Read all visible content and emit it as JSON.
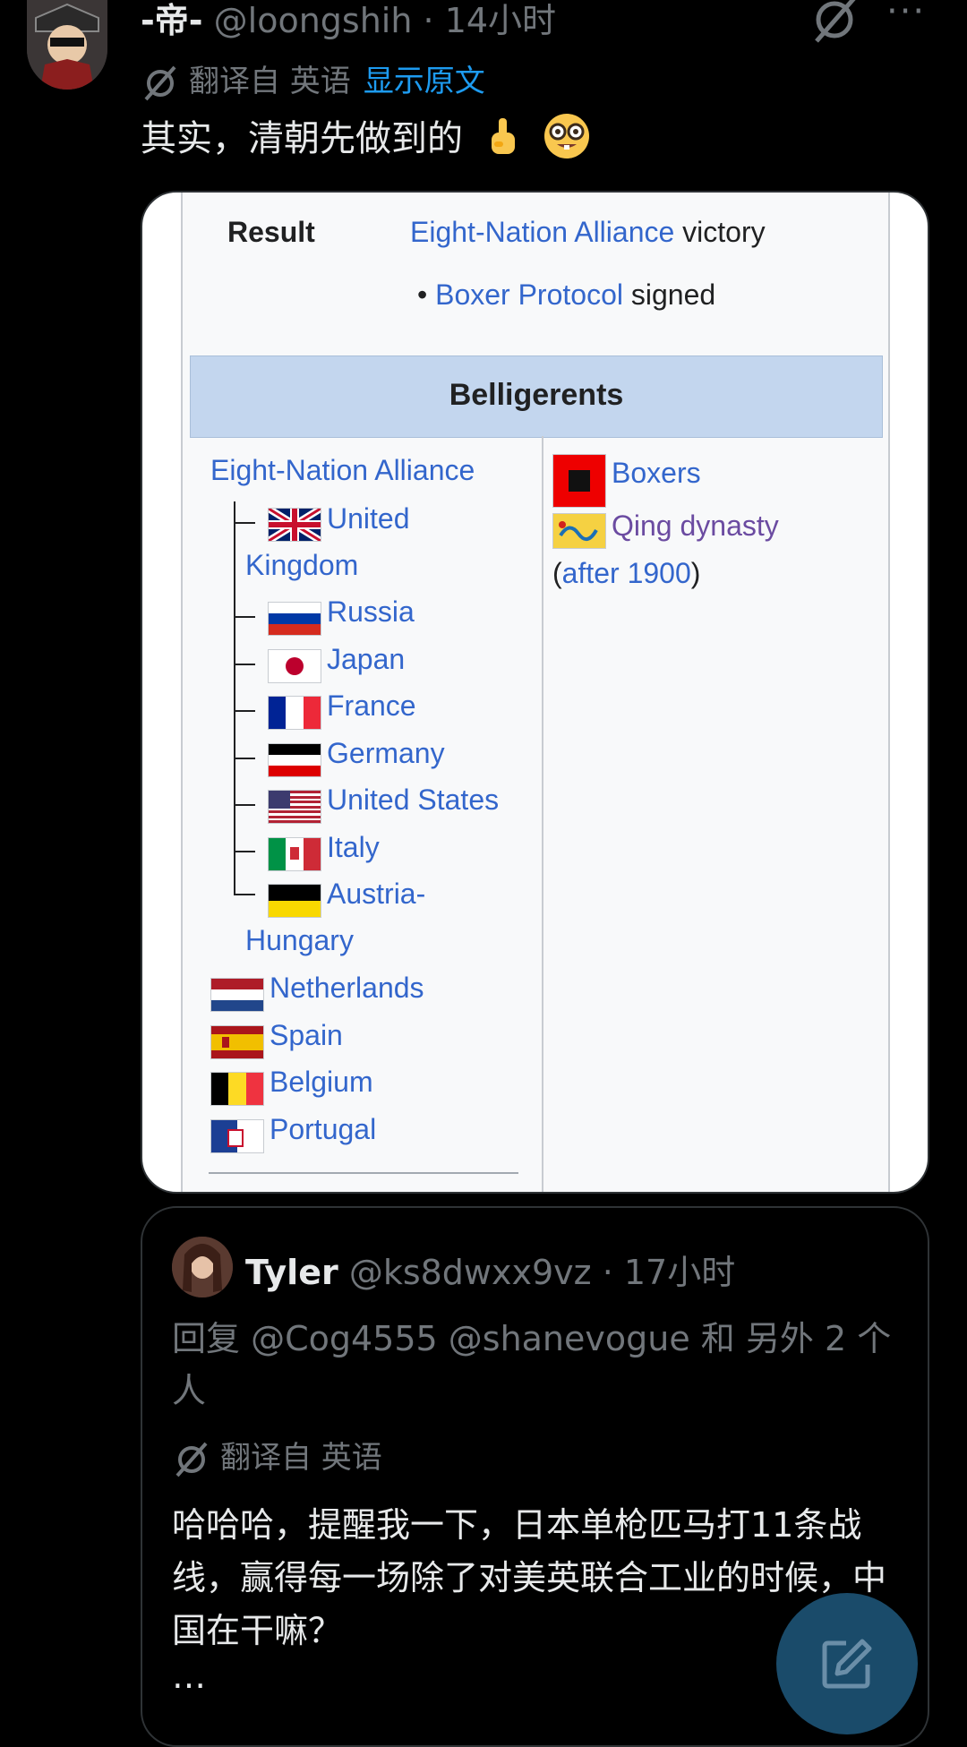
{
  "tweet": {
    "display_name": "-帝-",
    "handle": "@loongshih",
    "separator": " · ",
    "time": "14小时",
    "translated_from": "翻译自 英语",
    "show_original": "显示原文",
    "text": "其实，清朝先做到的",
    "more": "···"
  },
  "wiki": {
    "result_label": "Result",
    "result_link": "Eight-Nation Alliance",
    "result_text": "victory",
    "bullet": "•",
    "protocol_link": "Boxer Protocol",
    "protocol_text": "signed",
    "belligerents": "Belligerents",
    "alliance": "Eight-Nation Alliance",
    "left_members": [
      "United",
      "Kingdom",
      "Russia",
      "Japan",
      "France",
      "Germany",
      "United States",
      "Italy",
      "Austria-",
      "Hungary"
    ],
    "left_others": [
      "Netherlands",
      "Spain",
      "Belgium",
      "Portugal"
    ],
    "right_boxers": "Boxers",
    "right_qing": "Qing dynasty",
    "paren_open": "(",
    "right_after": "after 1900",
    "paren_close": ")"
  },
  "quote": {
    "display_name": "Tyler",
    "handle": "@ks8dwxx9vz",
    "separator": " · ",
    "time": "17小时",
    "reply": "回复 @Cog4555 @shanevogue 和 另外 2 个人",
    "translated_from": "翻译自 英语",
    "text": "哈哈哈，提醒我一下，日本单枪匹马打11条战线，赢得每一场除了对美英联合工业的时候，中国在干嘛？",
    "ellipsis": "…"
  },
  "colors": {
    "background": "#000000",
    "link_blue": "#1d9bf0",
    "muted": "#71767b",
    "wiki_link": "#3366cc",
    "wiki_visited": "#6b4ba1",
    "wiki_header": "#c3d6ee"
  },
  "icons": [
    "grok-icon",
    "more-icon",
    "translate-icon",
    "compose-icon"
  ]
}
